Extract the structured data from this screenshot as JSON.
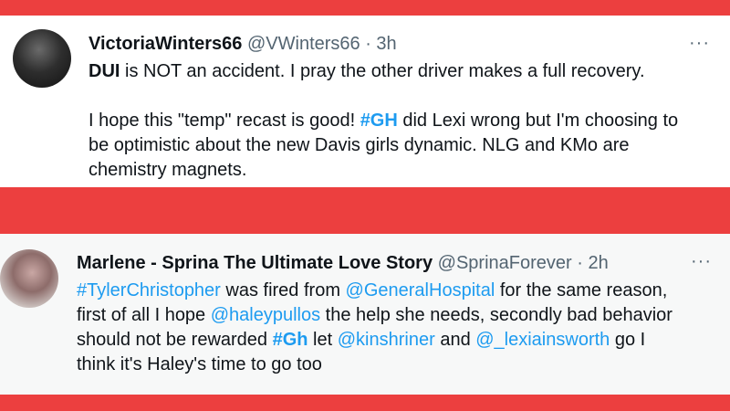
{
  "tweets": [
    {
      "name": "VictoriaWinters66",
      "handle_time": " @VWinters66 · 3h",
      "more": "···",
      "lines": [
        [
          {
            "t": "DUI",
            "s": "bold"
          },
          {
            "t": " is NOT an accident. I pray the other driver makes a full recovery.",
            "s": ""
          }
        ],
        [
          {
            "t": "I hope this \"temp\" recast is good! ",
            "s": ""
          },
          {
            "t": "#GH",
            "s": "tag-bold"
          },
          {
            "t": " did Lexi wrong but I'm choosing to",
            "s": ""
          }
        ],
        [
          {
            "t": "be optimistic about the new Davis girls dynamic. NLG and KMo are",
            "s": ""
          }
        ],
        [
          {
            "t": "chemistry magnets.",
            "s": ""
          }
        ]
      ]
    },
    {
      "name": "Marlene - Sprina The Ultimate Love Story",
      "handle_time": " @SprinaForever · 2h",
      "more": "···",
      "lines": [
        [
          {
            "t": "#TylerChristopher",
            "s": "tag"
          },
          {
            "t": " was fired from ",
            "s": ""
          },
          {
            "t": "@GeneralHospital",
            "s": "tag"
          },
          {
            "t": " for the same reason,",
            "s": ""
          }
        ],
        [
          {
            "t": "first of all I hope ",
            "s": ""
          },
          {
            "t": "@haleypullos",
            "s": "tag"
          },
          {
            "t": " the help she needs, secondly bad behavior",
            "s": ""
          }
        ],
        [
          {
            "t": "should not be rewarded ",
            "s": ""
          },
          {
            "t": "#Gh",
            "s": "tag-bold"
          },
          {
            "t": " let ",
            "s": ""
          },
          {
            "t": "@kinshriner",
            "s": "tag"
          },
          {
            "t": " and ",
            "s": ""
          },
          {
            "t": "@_lexiainsworth",
            "s": "tag"
          },
          {
            "t": " go I",
            "s": ""
          }
        ],
        [
          {
            "t": "think it's Haley's time to go too",
            "s": ""
          }
        ]
      ]
    }
  ]
}
